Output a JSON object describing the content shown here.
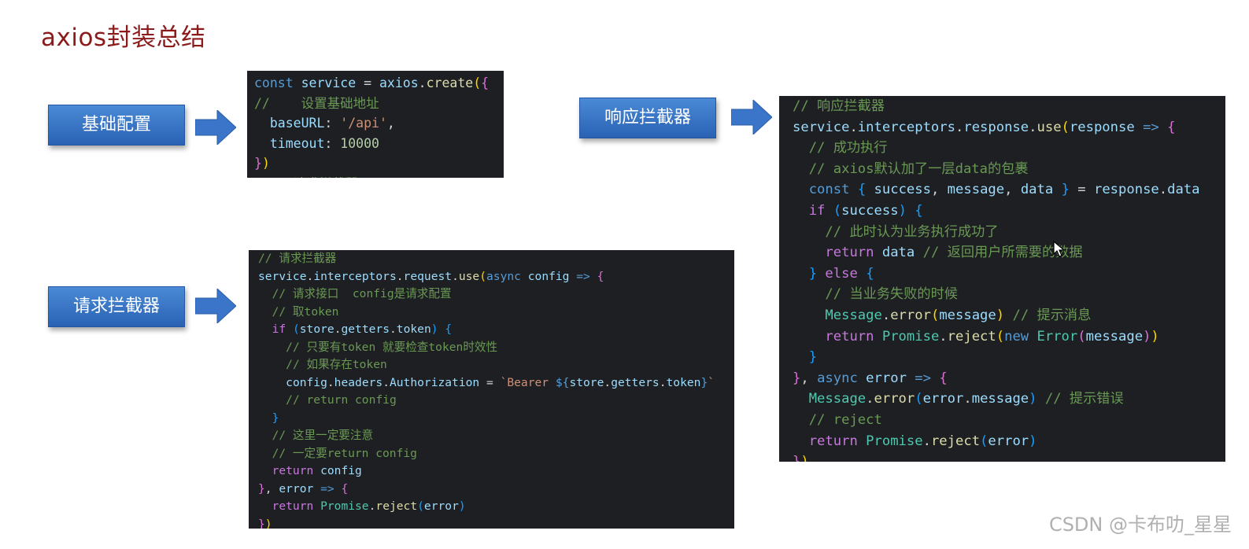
{
  "title": "axios封装总结",
  "labels": {
    "base_config": "基础配置",
    "response_interceptor": "响应拦截器",
    "request_interceptor": "请求拦截器"
  },
  "watermark": "CSDN @卡布叻_星星",
  "colors": {
    "title": "#8b1a1a",
    "label_button": "#2f6dbf",
    "arrow": "#3b75c9",
    "code_bg": "#1e1f22"
  },
  "code": {
    "base": [
      [
        [
          "kw2",
          "const"
        ],
        [
          "pl",
          " "
        ],
        [
          "id",
          "service"
        ],
        [
          "pl",
          " = "
        ],
        [
          "id",
          "axios"
        ],
        [
          "pl",
          "."
        ],
        [
          "fn",
          "create"
        ],
        [
          "br1",
          "("
        ],
        [
          "br2",
          "{"
        ]
      ],
      [
        [
          "cm",
          "//    设置基础地址"
        ]
      ],
      [
        [
          "pl",
          "  "
        ],
        [
          "id",
          "baseURL"
        ],
        [
          "pl",
          ": "
        ],
        [
          "str",
          "'/api'"
        ],
        [
          "pl",
          ","
        ]
      ],
      [
        [
          "pl",
          "  "
        ],
        [
          "id",
          "timeout"
        ],
        [
          "pl",
          ": "
        ],
        [
          "num",
          "10000"
        ]
      ],
      [
        [
          "br2",
          "}"
        ],
        [
          "br1",
          ")"
        ]
      ],
      [
        [
          "cm",
          "  // 请求拦截器"
        ]
      ]
    ],
    "request": [
      [
        [
          "cm",
          "// 请求拦截器"
        ]
      ],
      [
        [
          "id",
          "service"
        ],
        [
          "pl",
          "."
        ],
        [
          "id",
          "interceptors"
        ],
        [
          "pl",
          "."
        ],
        [
          "id",
          "request"
        ],
        [
          "pl",
          "."
        ],
        [
          "fn",
          "use"
        ],
        [
          "br1",
          "("
        ],
        [
          "kw2",
          "async"
        ],
        [
          "pl",
          " "
        ],
        [
          "id",
          "config"
        ],
        [
          "pl",
          " "
        ],
        [
          "kw2",
          "=>"
        ],
        [
          "pl",
          " "
        ],
        [
          "br2",
          "{"
        ]
      ],
      [
        [
          "pl",
          "  "
        ],
        [
          "cm",
          "// 请求接口  config是请求配置"
        ]
      ],
      [
        [
          "pl",
          "  "
        ],
        [
          "cm",
          "// 取token"
        ]
      ],
      [
        [
          "pl",
          "  "
        ],
        [
          "kw",
          "if"
        ],
        [
          "pl",
          " "
        ],
        [
          "br3",
          "("
        ],
        [
          "id",
          "store"
        ],
        [
          "pl",
          "."
        ],
        [
          "id",
          "getters"
        ],
        [
          "pl",
          "."
        ],
        [
          "id",
          "token"
        ],
        [
          "br3",
          ")"
        ],
        [
          "pl",
          " "
        ],
        [
          "br3",
          "{"
        ]
      ],
      [
        [
          "pl",
          "    "
        ],
        [
          "cm",
          "// 只要有token 就要检查token时效性"
        ]
      ],
      [
        [
          "pl",
          "    "
        ],
        [
          "cm",
          "// 如果存在token"
        ]
      ],
      [
        [
          "pl",
          "    "
        ],
        [
          "id",
          "config"
        ],
        [
          "pl",
          "."
        ],
        [
          "id",
          "headers"
        ],
        [
          "pl",
          "."
        ],
        [
          "id",
          "Authorization"
        ],
        [
          "pl",
          " = "
        ],
        [
          "str",
          "`Bearer "
        ],
        [
          "kw2",
          "${"
        ],
        [
          "id",
          "store"
        ],
        [
          "pl",
          "."
        ],
        [
          "id",
          "getters"
        ],
        [
          "pl",
          "."
        ],
        [
          "id",
          "token"
        ],
        [
          "kw2",
          "}"
        ],
        [
          "str",
          "`"
        ]
      ],
      [
        [
          "pl",
          "    "
        ],
        [
          "cm",
          "// return config"
        ]
      ],
      [
        [
          "pl",
          "  "
        ],
        [
          "br3",
          "}"
        ]
      ],
      [
        [
          "pl",
          "  "
        ],
        [
          "cm",
          "// 这里一定要注意"
        ]
      ],
      [
        [
          "pl",
          "  "
        ],
        [
          "cm",
          "// 一定要return config"
        ]
      ],
      [
        [
          "pl",
          "  "
        ],
        [
          "kw",
          "return"
        ],
        [
          "pl",
          " "
        ],
        [
          "id",
          "config"
        ]
      ],
      [
        [
          "br2",
          "}"
        ],
        [
          "pl",
          ", "
        ],
        [
          "id",
          "error"
        ],
        [
          "pl",
          " "
        ],
        [
          "kw2",
          "=>"
        ],
        [
          "pl",
          " "
        ],
        [
          "br2",
          "{"
        ]
      ],
      [
        [
          "pl",
          "  "
        ],
        [
          "kw",
          "return"
        ],
        [
          "pl",
          " "
        ],
        [
          "cls",
          "Promise"
        ],
        [
          "pl",
          "."
        ],
        [
          "fn",
          "reject"
        ],
        [
          "br3",
          "("
        ],
        [
          "id",
          "error"
        ],
        [
          "br3",
          ")"
        ]
      ],
      [
        [
          "br2",
          "}"
        ],
        [
          "br1",
          ")"
        ]
      ]
    ],
    "response": [
      [
        [
          "cm",
          "// 响应拦截器"
        ]
      ],
      [
        [
          "id",
          "service"
        ],
        [
          "pl",
          "."
        ],
        [
          "id",
          "interceptors"
        ],
        [
          "pl",
          "."
        ],
        [
          "id",
          "response"
        ],
        [
          "pl",
          "."
        ],
        [
          "fn",
          "use"
        ],
        [
          "br1",
          "("
        ],
        [
          "id",
          "response"
        ],
        [
          "pl",
          " "
        ],
        [
          "kw2",
          "=>"
        ],
        [
          "pl",
          " "
        ],
        [
          "br2",
          "{"
        ]
      ],
      [
        [
          "pl",
          "  "
        ],
        [
          "cm",
          "// 成功执行"
        ]
      ],
      [
        [
          "pl",
          "  "
        ],
        [
          "cm",
          "// axios默认加了一层data的包裹"
        ]
      ],
      [
        [
          "pl",
          "  "
        ],
        [
          "kw2",
          "const"
        ],
        [
          "pl",
          " "
        ],
        [
          "br3",
          "{"
        ],
        [
          "pl",
          " "
        ],
        [
          "id",
          "success"
        ],
        [
          "pl",
          ", "
        ],
        [
          "id",
          "message"
        ],
        [
          "pl",
          ", "
        ],
        [
          "id",
          "data"
        ],
        [
          "pl",
          " "
        ],
        [
          "br3",
          "}"
        ],
        [
          "pl",
          " = "
        ],
        [
          "id",
          "response"
        ],
        [
          "pl",
          "."
        ],
        [
          "id",
          "data"
        ]
      ],
      [
        [
          "pl",
          "  "
        ],
        [
          "kw",
          "if"
        ],
        [
          "pl",
          " "
        ],
        [
          "br3",
          "("
        ],
        [
          "id",
          "success"
        ],
        [
          "br3",
          ")"
        ],
        [
          "pl",
          " "
        ],
        [
          "br3",
          "{"
        ]
      ],
      [
        [
          "pl",
          "    "
        ],
        [
          "cm",
          "// 此时认为业务执行成功了"
        ]
      ],
      [
        [
          "pl",
          "    "
        ],
        [
          "kw",
          "return"
        ],
        [
          "pl",
          " "
        ],
        [
          "id",
          "data"
        ],
        [
          "pl",
          " "
        ],
        [
          "cm",
          "// 返回用户所需要的数据"
        ]
      ],
      [
        [
          "pl",
          "  "
        ],
        [
          "br3",
          "}"
        ],
        [
          "pl",
          " "
        ],
        [
          "kw",
          "else"
        ],
        [
          "pl",
          " "
        ],
        [
          "br3",
          "{"
        ]
      ],
      [
        [
          "pl",
          "    "
        ],
        [
          "cm",
          "// 当业务失败的时候"
        ]
      ],
      [
        [
          "pl",
          "    "
        ],
        [
          "cls",
          "Message"
        ],
        [
          "pl",
          "."
        ],
        [
          "fn",
          "error"
        ],
        [
          "br1",
          "("
        ],
        [
          "id",
          "message"
        ],
        [
          "br1",
          ")"
        ],
        [
          "pl",
          " "
        ],
        [
          "cm",
          "// 提示消息"
        ]
      ],
      [
        [
          "pl",
          "    "
        ],
        [
          "kw",
          "return"
        ],
        [
          "pl",
          " "
        ],
        [
          "cls",
          "Promise"
        ],
        [
          "pl",
          "."
        ],
        [
          "fn",
          "reject"
        ],
        [
          "br1",
          "("
        ],
        [
          "kw2",
          "new"
        ],
        [
          "pl",
          " "
        ],
        [
          "cls",
          "Error"
        ],
        [
          "br2",
          "("
        ],
        [
          "id",
          "message"
        ],
        [
          "br2",
          ")"
        ],
        [
          "br1",
          ")"
        ]
      ],
      [
        [
          "pl",
          "  "
        ],
        [
          "br3",
          "}"
        ]
      ],
      [
        [
          "br2",
          "}"
        ],
        [
          "pl",
          ", "
        ],
        [
          "kw2",
          "async"
        ],
        [
          "pl",
          " "
        ],
        [
          "id",
          "error"
        ],
        [
          "pl",
          " "
        ],
        [
          "kw2",
          "=>"
        ],
        [
          "pl",
          " "
        ],
        [
          "br2",
          "{"
        ]
      ],
      [
        [
          "pl",
          "  "
        ],
        [
          "cls",
          "Message"
        ],
        [
          "pl",
          "."
        ],
        [
          "fn",
          "error"
        ],
        [
          "br3",
          "("
        ],
        [
          "id",
          "error"
        ],
        [
          "pl",
          "."
        ],
        [
          "id",
          "message"
        ],
        [
          "br3",
          ")"
        ],
        [
          "pl",
          " "
        ],
        [
          "cm",
          "// 提示错误"
        ]
      ],
      [
        [
          "pl",
          "  "
        ],
        [
          "cm",
          "// reject"
        ]
      ],
      [
        [
          "pl",
          "  "
        ],
        [
          "kw",
          "return"
        ],
        [
          "pl",
          " "
        ],
        [
          "cls",
          "Promise"
        ],
        [
          "pl",
          "."
        ],
        [
          "fn",
          "reject"
        ],
        [
          "br3",
          "("
        ],
        [
          "id",
          "error"
        ],
        [
          "br3",
          ")"
        ]
      ],
      [
        [
          "br2",
          "}"
        ],
        [
          "br1",
          ")"
        ]
      ]
    ]
  }
}
